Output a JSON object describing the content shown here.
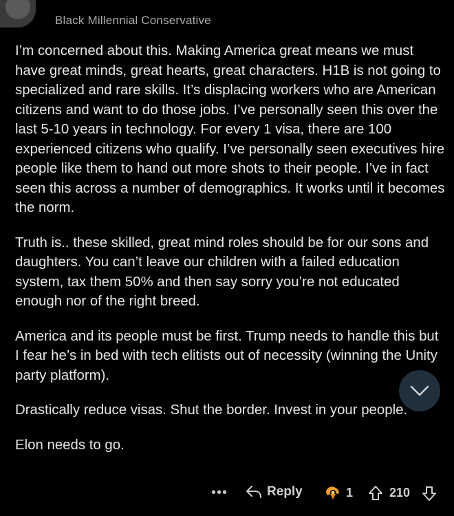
{
  "comment": {
    "username": "Black Millennial Conservative",
    "paragraphs": [
      "I’m concerned about this. Making America great means we must have great minds, great hearts, great characters. H1B is not going to specialized and rare skills. It’s displacing workers who are American citizens and want to do those jobs. I’ve personally seen this over the last 5-10 years in technology. For every 1 visa, there are 100 experienced citizens who qualify. I’ve personally seen executives hire people like them to hand out more shots to their people. I’ve in fact seen this across a number of demographics. It works until it becomes the norm.",
      "Truth is.. these skilled, great mind roles should be for our sons and daughters. You can’t leave our children with a failed education system, tax them 50% and then say sorry you’re not educated enough nor of the right breed.",
      "America and its people must be first. Trump needs to handle this but I fear he’s in bed with tech elitists out of necessity (winning the Unity party platform).",
      "Drastically reduce visas. Shut the border. Invest in your people.",
      "Elon needs to go."
    ]
  },
  "actions": {
    "more_label": "•••",
    "reply_label": "Reply",
    "award_count": "1",
    "vote_count": "210"
  },
  "icons": {
    "more": "more-options-icon",
    "reply": "reply-arrow-icon",
    "award": "award-icon",
    "upvote": "upvote-arrow-icon",
    "downvote": "downvote-arrow-icon",
    "scroll": "chevron-down-icon"
  },
  "colors": {
    "background": "#000000",
    "text": "#e6e6e6",
    "username": "#a9a9a9",
    "fab": "#213340",
    "award": "#f0a020"
  }
}
